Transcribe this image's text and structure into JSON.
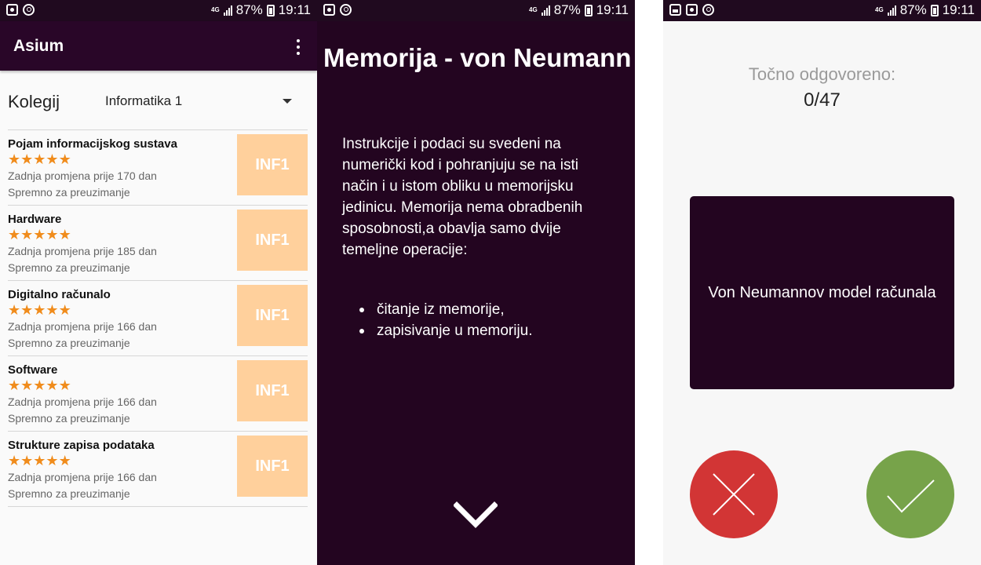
{
  "status_bar": {
    "network": "4G",
    "battery": "87%",
    "time": "19:11"
  },
  "screen1": {
    "app_title": "Asium",
    "kolegij_label": "Kolegij",
    "kolegij_value": "Informatika 1",
    "courses": [
      {
        "title": "Pojam informacijskog sustava",
        "rating": 5,
        "changed": "Zadnja promjena prije 170 dan",
        "status": "Spremno za preuzimanje",
        "badge": "INF1"
      },
      {
        "title": "Hardware",
        "rating": 5,
        "changed": "Zadnja promjena prije 185 dan",
        "status": "Spremno za preuzimanje",
        "badge": "INF1"
      },
      {
        "title": "Digitalno računalo",
        "rating": 5,
        "changed": "Zadnja promjena prije 166 dan",
        "status": "Spremno za preuzimanje",
        "badge": "INF1"
      },
      {
        "title": "Software",
        "rating": 5,
        "changed": "Zadnja promjena prije 166 dan",
        "status": "Spremno za preuzimanje",
        "badge": "INF1"
      },
      {
        "title": "Strukture zapisa podataka",
        "rating": 5,
        "changed": "Zadnja promjena prije 166 dan",
        "status": "Spremno za preuzimanje",
        "badge": "INF1"
      }
    ]
  },
  "screen2": {
    "title": "Memorija - von Neumann",
    "body": "Instrukcije i podaci su svedeni na numerički kod i pohranjuju se na isti način i u istom obliku u memorijsku jedinicu. Memorija nema obradbenih sposobnosti,a obavlja samo dvije temeljne operacije:",
    "bullets": [
      "čitanje iz memorije,",
      "zapisivanje u memoriju."
    ],
    "next_icon": "chevron-down-icon"
  },
  "screen3": {
    "score_label": "Točno odgovoreno:",
    "score_value": "0/47",
    "card_text": "Von Neumannov model računala",
    "wrong_icon": "close-icon",
    "right_icon": "check-icon"
  },
  "colors": {
    "primary_dark": "#230520",
    "star": "#f08c1c",
    "badge_bg": "#ffd09c",
    "wrong": "#d23535",
    "right": "#77a34a"
  }
}
